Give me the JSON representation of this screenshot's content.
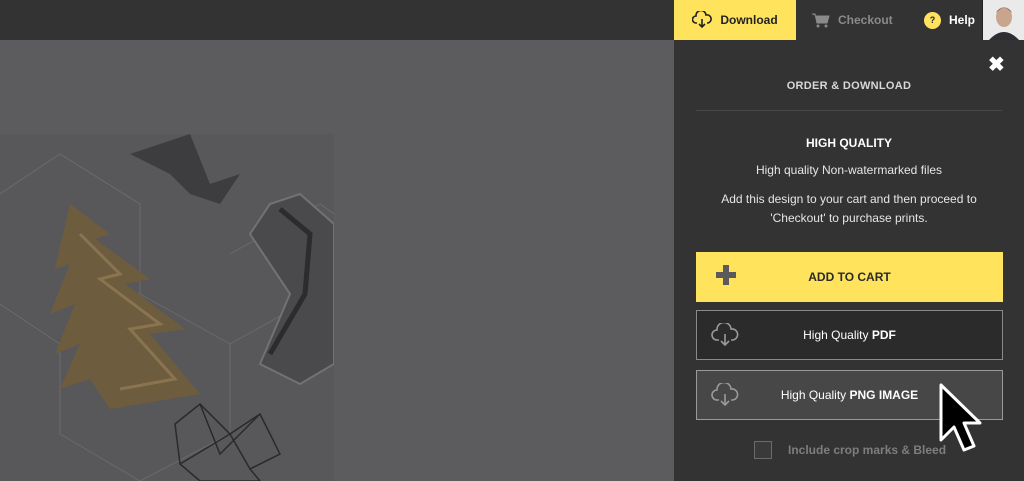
{
  "topbar": {
    "download_label": "Download",
    "checkout_label": "Checkout",
    "help_label": "Help",
    "help_badge": "?",
    "icons": {
      "download": "cloud-download-icon",
      "checkout": "cart-icon",
      "help": "question-icon",
      "avatar": "user-avatar"
    }
  },
  "panel": {
    "title": "ORDER & DOWNLOAD",
    "close_glyph": "✖",
    "section_title": "HIGH QUALITY",
    "subtitle": "High quality Non-watermarked files",
    "description": "Add this design to your cart and then proceed to 'Checkout' to purchase prints.",
    "add_to_cart_label": "ADD TO CART",
    "pdf": {
      "prefix": "High Quality ",
      "strong": "PDF"
    },
    "png": {
      "prefix": "High Quality ",
      "strong": "PNG IMAGE"
    },
    "crop_label": "Include crop marks & Bleed",
    "crop_checked": false
  },
  "colors": {
    "accent": "#ffe35c",
    "topbar": "#333333",
    "panel": "#333333",
    "canvas": "#5c5c5f"
  }
}
